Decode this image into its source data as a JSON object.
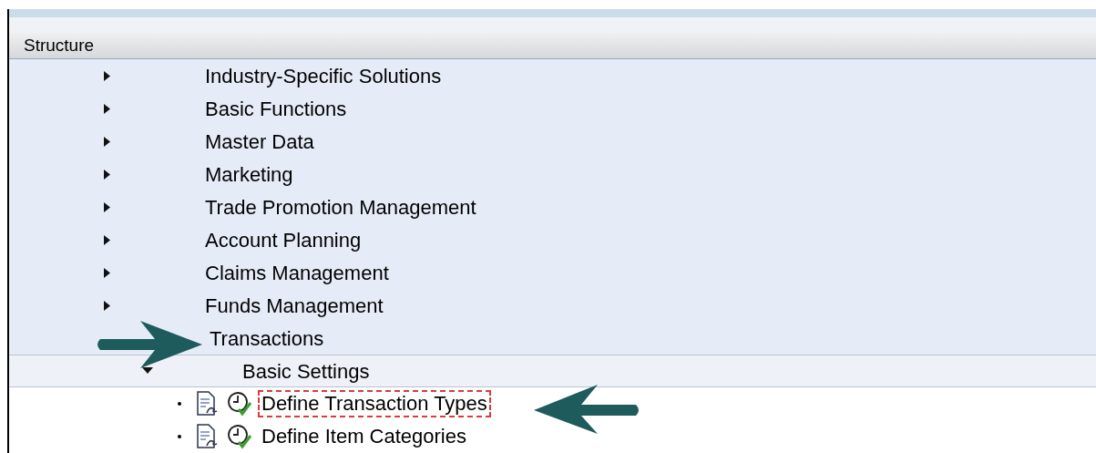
{
  "header": {
    "title": "Structure"
  },
  "tree": [
    {
      "label": "Industry-Specific Solutions",
      "expanded": false
    },
    {
      "label": "Basic Functions",
      "expanded": false
    },
    {
      "label": "Master Data",
      "expanded": false
    },
    {
      "label": "Marketing",
      "expanded": false
    },
    {
      "label": "Trade Promotion Management",
      "expanded": false
    },
    {
      "label": "Account Planning",
      "expanded": false
    },
    {
      "label": "Claims Management",
      "expanded": false
    },
    {
      "label": "Funds Management",
      "expanded": false
    },
    {
      "label": "Transactions",
      "expanded": true,
      "children": [
        {
          "label": "Basic Settings",
          "expanded": true,
          "children": [
            {
              "label": "Define Transaction Types",
              "kind": "activity",
              "selected": true
            },
            {
              "label": "Define Item Categories",
              "kind": "activity",
              "selected": false
            }
          ]
        }
      ]
    }
  ]
}
